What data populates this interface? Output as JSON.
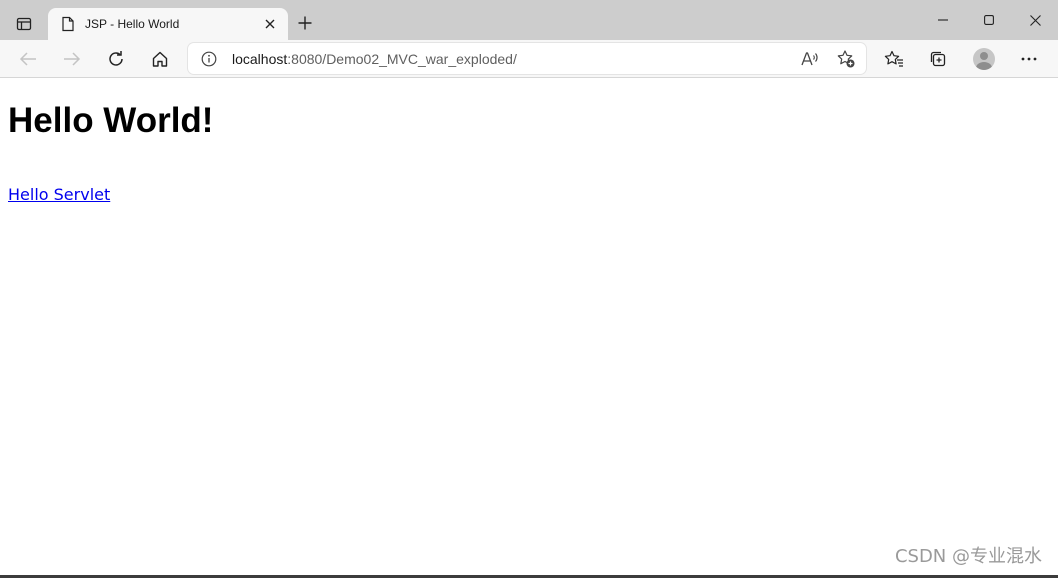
{
  "tab": {
    "title": "JSP - Hello World"
  },
  "address_bar": {
    "url_host": "localhost",
    "url_rest": ":8080/Demo02_MVC_war_exploded/"
  },
  "icons": {
    "tab_actions": "tab-actions-icon",
    "page": "page-icon",
    "close_tab": "close-icon",
    "new_tab": "plus-icon",
    "minimize": "minimize-icon",
    "maximize": "maximize-icon",
    "close_window": "close-icon",
    "back": "arrow-left-icon",
    "forward": "arrow-right-icon",
    "refresh": "refresh-icon",
    "home": "home-icon",
    "site_info": "info-icon",
    "read_aloud": "read-aloud-icon",
    "add_favorite": "star-plus-icon",
    "favorites": "favorites-icon",
    "collections": "collections-icon",
    "profile": "avatar",
    "more": "more-icon"
  },
  "page": {
    "heading": "Hello World!",
    "link_text": "Hello Servlet"
  },
  "watermark": "CSDN @专业混水",
  "colors": {
    "tabstrip": "#cdcdcd",
    "toolbar": "#f7f7f7",
    "link": "#0000ee"
  }
}
